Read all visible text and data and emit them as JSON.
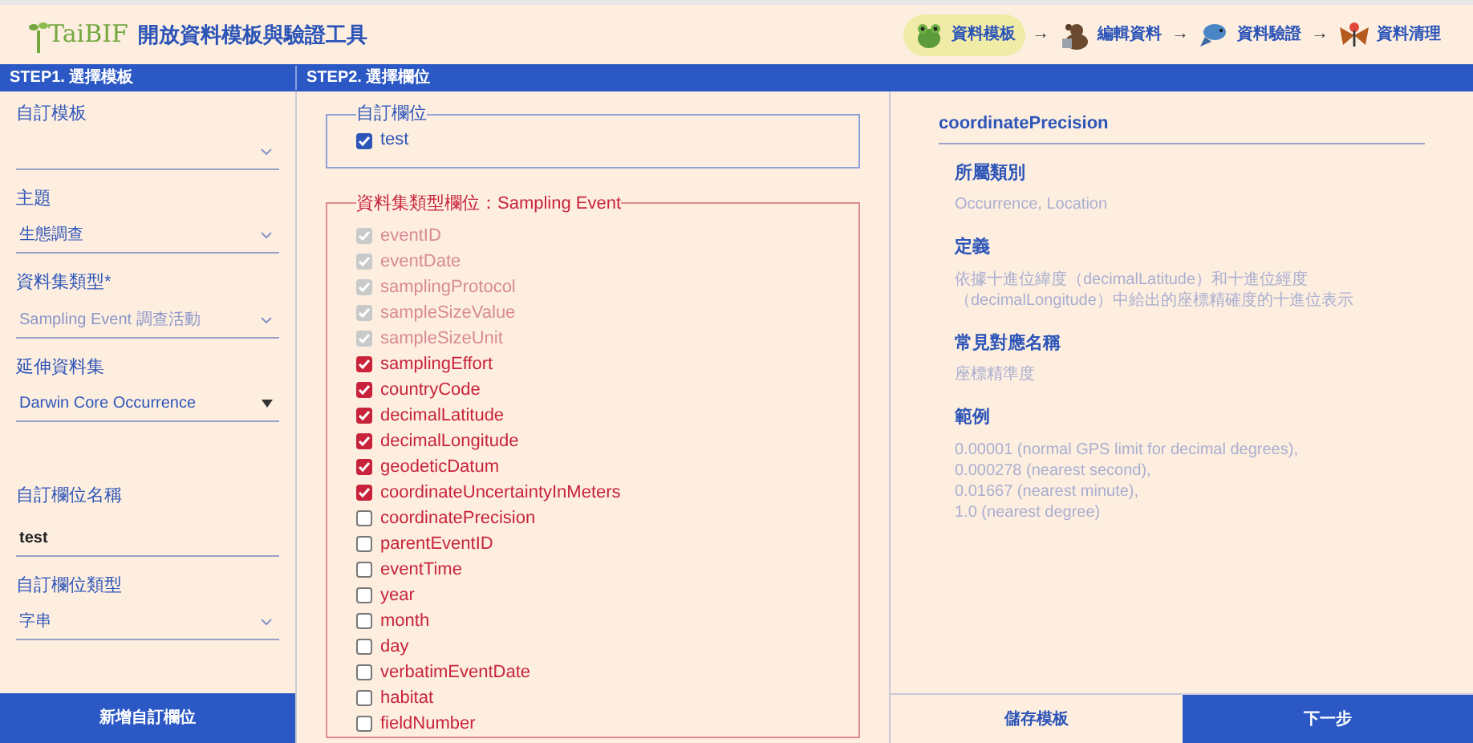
{
  "header": {
    "logo_text": "TaiBIF",
    "title": "開放資料模板與驗證工具",
    "steps": [
      {
        "kind": "frog",
        "label": "資料模板",
        "selected": true
      },
      {
        "kind": "bear",
        "label": "編輯資料",
        "selected": false
      },
      {
        "kind": "fish",
        "label": "資料驗證",
        "selected": false
      },
      {
        "kind": "butterfly",
        "label": "資料清理",
        "selected": false
      }
    ],
    "arrow": "→"
  },
  "step_bar": [
    "STEP1. 選擇模板",
    "STEP2. 選擇欄位"
  ],
  "left_panel": {
    "fields": [
      {
        "kind": "select",
        "label": "自訂模板"
      },
      {
        "kind": "select",
        "label": "主題",
        "value": "生態調查",
        "muted": false
      },
      {
        "kind": "select",
        "label": "資料集類型*",
        "value": "Sampling Event 調查活動",
        "muted": true
      },
      {
        "kind": "dropdown",
        "label": "延伸資料集",
        "value": "Darwin Core Occurrence",
        "muted": false
      },
      {
        "kind": "text",
        "label": "自訂欄位名稱",
        "value": "test"
      },
      {
        "kind": "select",
        "label": "自訂欄位類型",
        "value": "字串",
        "muted": false
      }
    ],
    "button": "新增自訂欄位"
  },
  "custom_fields": {
    "legend": "自訂欄位",
    "items": [
      {
        "label": "test",
        "checked": true,
        "disabled": false
      }
    ]
  },
  "dataset_fields": {
    "legend": "資料集類型欄位：Sampling Event",
    "items": [
      {
        "label": "eventID",
        "checked": true,
        "disabled": true
      },
      {
        "label": "eventDate",
        "checked": true,
        "disabled": true
      },
      {
        "label": "samplingProtocol",
        "checked": true,
        "disabled": true
      },
      {
        "label": "sampleSizeValue",
        "checked": true,
        "disabled": true
      },
      {
        "label": "sampleSizeUnit",
        "checked": true,
        "disabled": true
      },
      {
        "label": "samplingEffort",
        "checked": true,
        "disabled": false
      },
      {
        "label": "countryCode",
        "checked": true,
        "disabled": false
      },
      {
        "label": "decimalLatitude",
        "checked": true,
        "disabled": false
      },
      {
        "label": "decimalLongitude",
        "checked": true,
        "disabled": false
      },
      {
        "label": "geodeticDatum",
        "checked": true,
        "disabled": false
      },
      {
        "label": "coordinateUncertaintyInMeters",
        "checked": true,
        "disabled": false
      },
      {
        "label": "coordinatePrecision",
        "checked": false,
        "disabled": false
      },
      {
        "label": "parentEventID",
        "checked": false,
        "disabled": false
      },
      {
        "label": "eventTime",
        "checked": false,
        "disabled": false
      },
      {
        "label": "year",
        "checked": false,
        "disabled": false
      },
      {
        "label": "month",
        "checked": false,
        "disabled": false
      },
      {
        "label": "day",
        "checked": false,
        "disabled": false
      },
      {
        "label": "verbatimEventDate",
        "checked": false,
        "disabled": false
      },
      {
        "label": "habitat",
        "checked": false,
        "disabled": false
      },
      {
        "label": "fieldNumber",
        "checked": false,
        "disabled": false
      }
    ]
  },
  "detail": {
    "title": "coordinatePrecision",
    "sections": [
      {
        "heading": "所屬類別",
        "lines": [
          "Occurrence, Location"
        ]
      },
      {
        "heading": "定義",
        "lines": [
          "依據十進位緯度（decimalLatitude）和十進位經度（decimalLongitude）中給出的座標精確度的十進位表示"
        ]
      },
      {
        "heading": "常見對應名稱",
        "lines": [
          "座標精準度"
        ]
      },
      {
        "heading": "範例",
        "lines": [
          "0.00001 (normal GPS limit for decimal degrees),",
          "0.000278 (nearest second),",
          "0.01667 (nearest minute),",
          "1.0 (nearest degree)"
        ]
      }
    ]
  },
  "footer_buttons": [
    {
      "label": "儲存模板",
      "primary": false
    },
    {
      "label": "下一步",
      "primary": true
    }
  ]
}
